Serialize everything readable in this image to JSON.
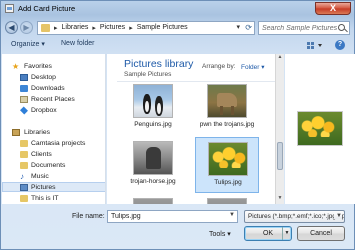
{
  "window": {
    "title": "Add Card Picture",
    "close_label": "X"
  },
  "address_bar": {
    "crumbs": [
      "Libraries",
      "Pictures",
      "Sample Pictures"
    ],
    "separator": "▸",
    "search_placeholder": "Search Sample Pictures"
  },
  "toolbar": {
    "organize_label": "Organize ▾",
    "new_folder_label": "New folder",
    "help_label": "?"
  },
  "nav": {
    "items": [
      {
        "label": "Favorites",
        "icon": "star-icon"
      },
      {
        "label": "Desktop",
        "icon": "desktop-icon"
      },
      {
        "label": "Downloads",
        "icon": "downloads-icon"
      },
      {
        "label": "Recent Places",
        "icon": "recent-places-icon"
      },
      {
        "label": "Dropbox",
        "icon": "dropbox-icon"
      },
      {
        "label": "Libraries",
        "icon": "libraries-icon"
      },
      {
        "label": "Camtasia projects",
        "icon": "folder-icon"
      },
      {
        "label": "Clients",
        "icon": "folder-icon"
      },
      {
        "label": "Documents",
        "icon": "documents-icon"
      },
      {
        "label": "Music",
        "icon": "music-icon"
      },
      {
        "label": "Pictures",
        "icon": "pictures-icon"
      },
      {
        "label": "This is IT",
        "icon": "folder-icon"
      }
    ],
    "selected": "Pictures"
  },
  "library": {
    "title": "Pictures library",
    "subtitle": "Sample Pictures",
    "arrange_label": "Arrange by:",
    "arrange_value": "Folder ▾"
  },
  "files": [
    {
      "name": "Penguins.jpg",
      "thumb": "penguins"
    },
    {
      "name": "pwn the trojans.jpg",
      "thumb": "pwn"
    },
    {
      "name": "trojan-horse.jpg",
      "thumb": "horse"
    },
    {
      "name": "Tulips.jpg",
      "thumb": "tulips",
      "selected": true
    }
  ],
  "bottom": {
    "file_name_label": "File name:",
    "file_name_value": "Tulips.jpg",
    "file_type": "Pictures (*.bmp;*.emf;*.ico;*.jpg;*.png)",
    "tools_label": "Tools ▾",
    "ok_label": "OK",
    "cancel_label": "Cancel"
  }
}
